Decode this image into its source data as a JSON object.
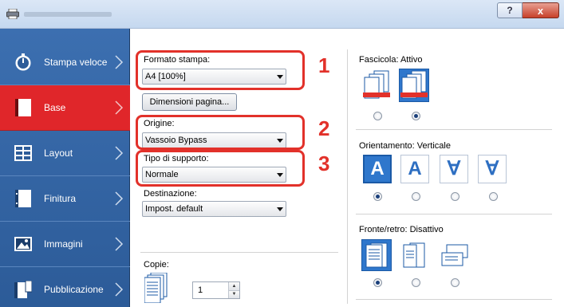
{
  "window": {
    "help_label": "?",
    "close_label": "x"
  },
  "sidebar": {
    "items": [
      {
        "label": "Stampa veloce",
        "icon": "stopwatch-icon",
        "active": false
      },
      {
        "label": "Base",
        "icon": "page-icon",
        "active": true
      },
      {
        "label": "Layout",
        "icon": "layout-grid-icon",
        "active": false
      },
      {
        "label": "Finitura",
        "icon": "finishing-icon",
        "active": false
      },
      {
        "label": "Immagini",
        "icon": "image-icon",
        "active": false
      },
      {
        "label": "Pubblicazione",
        "icon": "publication-icon",
        "active": false
      }
    ]
  },
  "basic": {
    "print_size": {
      "label": "Formato stampa:",
      "value": "A4  [100%]"
    },
    "page_size_button": "Dimensioni pagina...",
    "source": {
      "label": "Origine:",
      "value": "Vassoio Bypass"
    },
    "media_type": {
      "label": "Tipo di supporto:",
      "value": "Normale"
    },
    "destination": {
      "label": "Destinazione:",
      "value": "Impost. default"
    },
    "copies": {
      "label": "Copie:",
      "value": "1"
    }
  },
  "callouts": [
    "1",
    "2",
    "3"
  ],
  "collate": {
    "label": "Fascicola: Attivo",
    "selected_index": 1
  },
  "orientation": {
    "label": "Orientamento: Verticale",
    "selected_index": 0,
    "glyphs": [
      "A",
      "A",
      "∀",
      "∀"
    ]
  },
  "duplex": {
    "label": "Fronte/retro: Disattivo",
    "selected_index": 0
  },
  "colors": {
    "sidebar": "#2f5f9e",
    "active": "#e0262a",
    "callout": "#e2312a",
    "accent": "#2f77cc"
  }
}
